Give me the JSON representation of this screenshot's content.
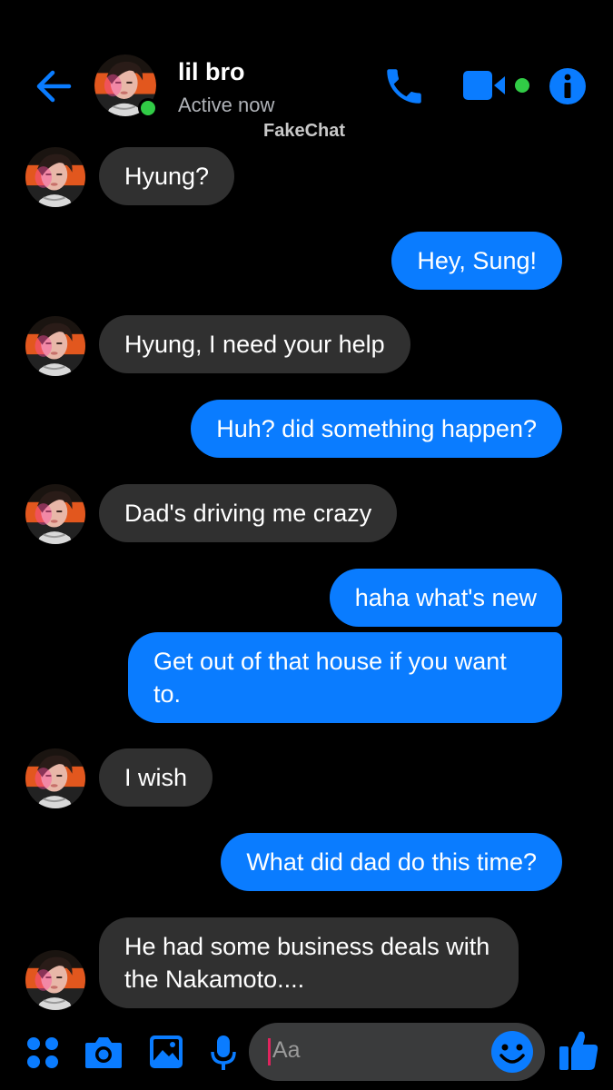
{
  "header": {
    "contact_name": "lil bro",
    "status": "Active now",
    "watermark": "FakeChat",
    "icons": [
      "back-arrow-icon",
      "phone-icon",
      "video-camera-icon",
      "info-icon"
    ]
  },
  "messages": [
    {
      "direction": "in",
      "text": "Hyung?"
    },
    {
      "direction": "out",
      "text": "Hey, Sung!"
    },
    {
      "direction": "in",
      "text": "Hyung,  I need your help"
    },
    {
      "direction": "out",
      "text": "Huh?  did something happen?"
    },
    {
      "direction": "in",
      "text": "Dad's driving me crazy"
    },
    {
      "direction": "out",
      "text": "haha what's new"
    },
    {
      "direction": "out",
      "text": "Get out of that house if you want to."
    },
    {
      "direction": "in",
      "text": "I wish"
    },
    {
      "direction": "out",
      "text": "What did dad do this time?"
    },
    {
      "direction": "in",
      "text": "He had some business deals with the Nakamoto...."
    }
  ],
  "composer": {
    "placeholder": "Aa",
    "icons": [
      "apps-grid-icon",
      "camera-icon",
      "image-icon",
      "microphone-icon",
      "emoji-icon",
      "thumbs-up-icon"
    ]
  },
  "colors": {
    "accent": "#0a7cff",
    "incoming_bubble": "#303030",
    "online": "#31cc46",
    "background": "#000000"
  }
}
